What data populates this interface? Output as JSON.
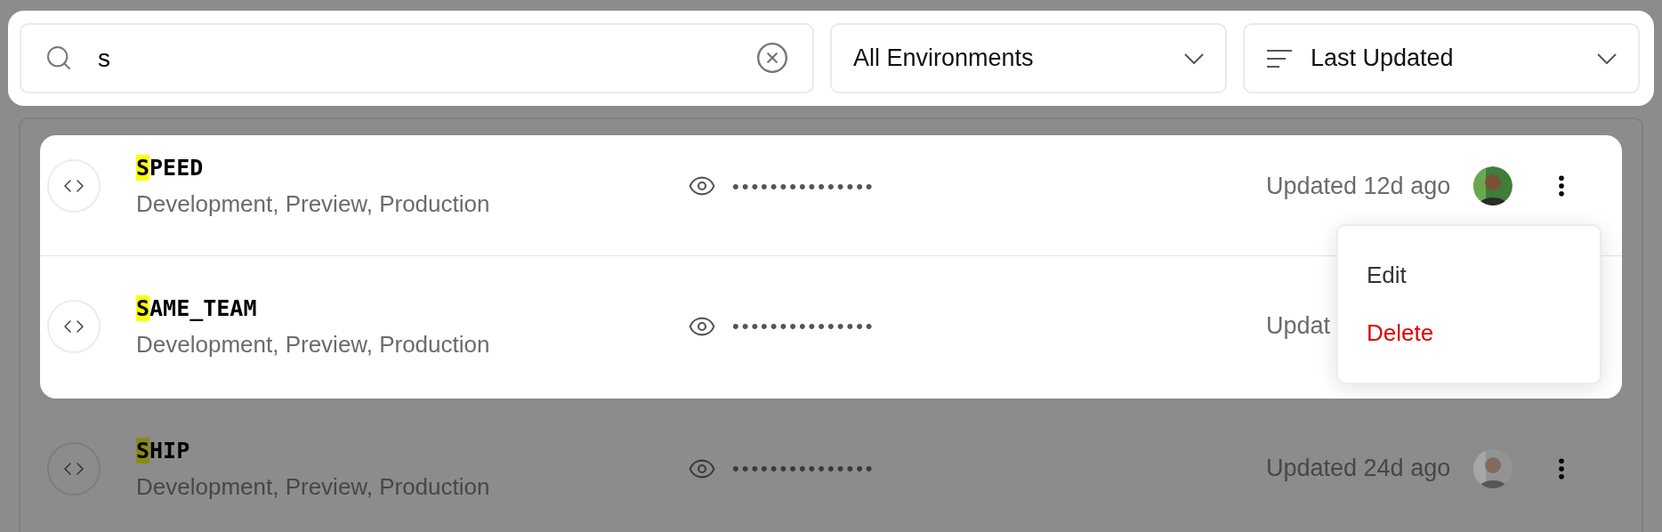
{
  "search": {
    "value": "s"
  },
  "filters": [
    {
      "kind": "environment",
      "label": "All Environments"
    },
    {
      "kind": "sort",
      "label": "Last Updated"
    }
  ],
  "rows": [
    {
      "name_match": "S",
      "name_rest": "PEED",
      "environments": "Development, Preview, Production",
      "value": "•••••••••••••••",
      "updated": "Updated 12d ago",
      "highlighted": true,
      "avatar": true
    },
    {
      "name_match": "S",
      "name_rest": "AME_TEAM",
      "environments": "Development, Preview, Production",
      "value": "•••••••••••••••",
      "updated": "Updat",
      "highlighted": true,
      "avatar": false
    },
    {
      "name_match": "S",
      "name_rest": "HIP",
      "environments": "Development, Preview, Production",
      "value": "•••••••••••••••",
      "updated": "Updated 24d ago",
      "highlighted": false,
      "avatar": true
    }
  ],
  "menu": {
    "items": [
      {
        "label": "Edit",
        "kind": "default"
      },
      {
        "label": "Delete",
        "kind": "danger"
      }
    ]
  }
}
